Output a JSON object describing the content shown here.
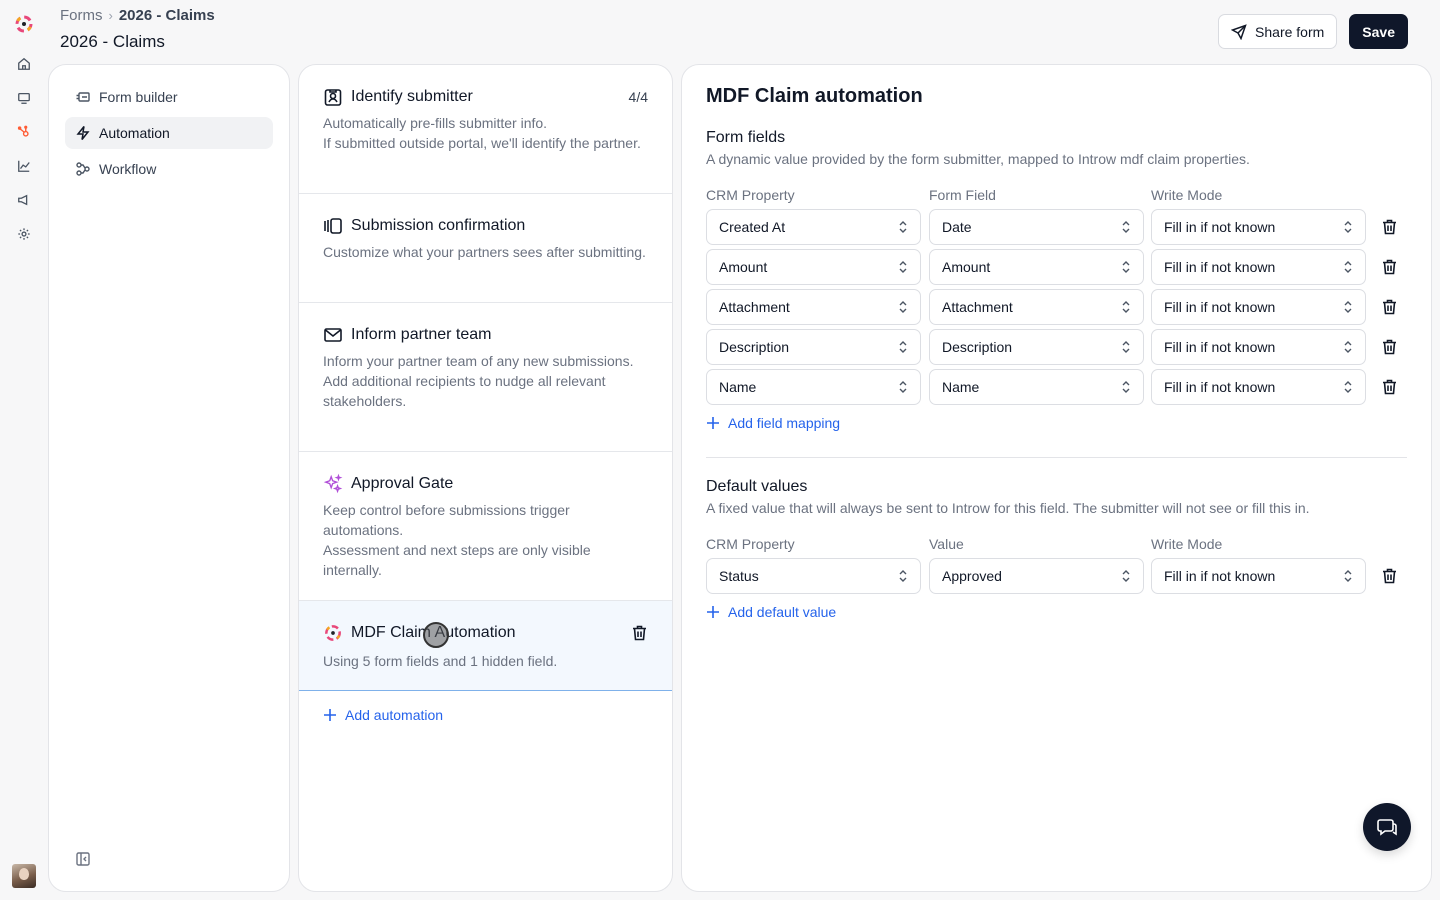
{
  "breadcrumb": {
    "root": "Forms",
    "current": "2026 - Claims"
  },
  "page_title": "2026 - Claims",
  "actions": {
    "share_label": "Share form",
    "save_label": "Save"
  },
  "nav": {
    "items": [
      {
        "label": "Form builder",
        "icon": "form-builder-icon"
      },
      {
        "label": "Automation",
        "icon": "lightning-icon"
      },
      {
        "label": "Workflow",
        "icon": "workflow-icon"
      }
    ]
  },
  "automations": [
    {
      "title": "Identify submitter",
      "badge": "4/4",
      "desc": [
        "Automatically pre-fills submitter info.",
        "If submitted outside portal, we'll identify the partner."
      ]
    },
    {
      "title": "Submission confirmation",
      "desc": [
        "Customize what your partners sees after submitting."
      ]
    },
    {
      "title": "Inform partner team",
      "desc": [
        "Inform your partner team of any new submissions.",
        "Add additional recipients to nudge all relevant stakeholders."
      ]
    },
    {
      "title": "Approval Gate",
      "desc": [
        "Keep control before submissions trigger automations.",
        "Assessment and next steps are only visible internally."
      ]
    },
    {
      "title": "MDF Claim Automation",
      "desc": [
        "Using 5 form fields and 1 hidden field."
      ]
    }
  ],
  "add_automation_label": "Add automation",
  "detail": {
    "title": "MDF Claim automation",
    "form_fields": {
      "title": "Form fields",
      "desc": "A dynamic value provided by the form submitter, mapped to Introw mdf claim properties.",
      "columns": [
        "CRM Property",
        "Form Field",
        "Write Mode"
      ],
      "rows": [
        [
          "Created At",
          "Date",
          "Fill in if not known"
        ],
        [
          "Amount",
          "Amount",
          "Fill in if not known"
        ],
        [
          "Attachment",
          "Attachment",
          "Fill in if not known"
        ],
        [
          "Description",
          "Description",
          "Fill in if not known"
        ],
        [
          "Name",
          "Name",
          "Fill in if not known"
        ]
      ],
      "add_label": "Add field mapping"
    },
    "default_values": {
      "title": "Default values",
      "desc": "A fixed value that will always be sent to Introw for this field. The submitter will not see or fill this in.",
      "columns": [
        "CRM Property",
        "Value",
        "Write Mode"
      ],
      "rows": [
        [
          "Status",
          "Approved",
          "Fill in if not known"
        ]
      ],
      "add_label": "Add default value"
    }
  },
  "colors": {
    "accent": "#2563eb",
    "primary_dark": "#0f172a",
    "brand_pink": "#e8477a",
    "brand_orange": "#f5a623",
    "hubspot_orange": "#ff5c35"
  }
}
